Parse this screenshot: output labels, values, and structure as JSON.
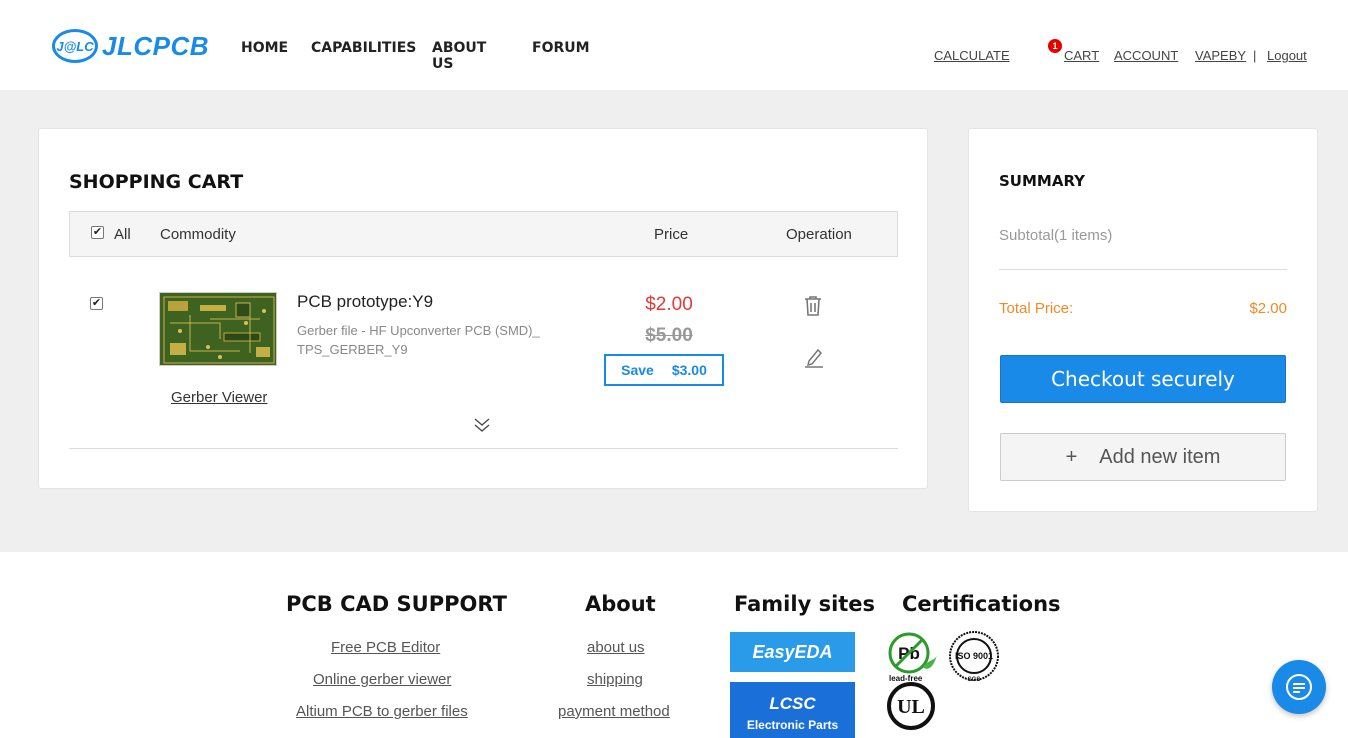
{
  "brand": {
    "logo_badge": "J@LC",
    "logo_text": "JLCPCB"
  },
  "mainnav": {
    "home": "HOME",
    "capabilities": "CAPABILITIES",
    "about": "ABOUT US",
    "forum": "FORUM"
  },
  "topnav": {
    "calculate": "CALCULATE",
    "cart_count": "1",
    "cart": "CART",
    "account": "ACCOUNT",
    "user": "VAPEBY",
    "separator": "|",
    "logout": "Logout"
  },
  "cart": {
    "title": "SHOPPING CART",
    "columns": {
      "all": "All",
      "commodity": "Commodity",
      "price": "Price",
      "operation": "Operation"
    },
    "items": [
      {
        "checked": true,
        "name": "PCB prototype:Y9",
        "description": "Gerber file - HF Upconverter PCB (SMD)_ TPS_GERBER_Y9",
        "viewer_link": "Gerber Viewer",
        "price": "$2.00",
        "original_price": "$5.00",
        "save_label": "Save",
        "save_amount": "$3.00",
        "icons": [
          "trash-icon",
          "edit-icon",
          "expand-icon"
        ]
      }
    ]
  },
  "summary": {
    "title": "SUMMARY",
    "subtotal": "Subtotal(1 items)",
    "total_label": "Total Price:",
    "total_value": "$2.00",
    "checkout": "Checkout securely",
    "add_icon": "+",
    "add_item": "Add new item"
  },
  "footer": {
    "pcb_cad": {
      "title": "PCB CAD SUPPORT",
      "links": [
        "Free PCB Editor",
        "Online gerber viewer",
        "Altium PCB to gerber files"
      ]
    },
    "about": {
      "title": "About",
      "links": [
        "about us",
        "shipping",
        "payment method"
      ]
    },
    "family": {
      "title": "Family sites",
      "easyeda": "EasyEDA",
      "lcsc": "LCSC",
      "lcsc_sub": "Electronic Parts"
    },
    "certs": {
      "title": "Certifications",
      "leadfree": "lead-free",
      "pb": "Pb",
      "iso": "ISO 9001",
      "sgs": "SGS",
      "ul": "UL"
    }
  },
  "colors": {
    "accent": "#1a8ae8",
    "price_red": "#e03a3a",
    "total_orange": "#f08a24",
    "badge_red": "#e60000"
  }
}
